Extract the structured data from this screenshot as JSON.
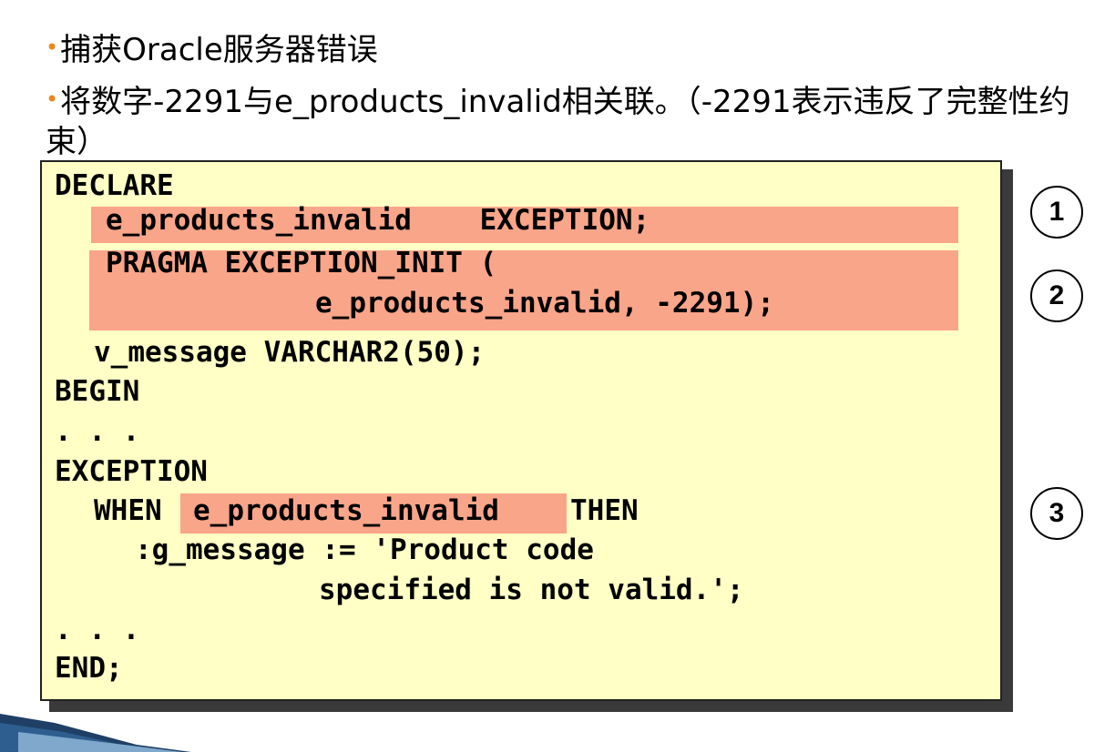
{
  "bullets": [
    {
      "text": "捕获Oracle服务器错误"
    },
    {
      "text": "将数字-2291与e_products_invalid相关联。（-2291表示违反了完整性约束）"
    }
  ],
  "code_lines": [
    "DECLARE",
    "e_products_invalid    EXCEPTION;",
    "PRAGMA EXCEPTION_INIT (",
    "e_products_invalid, -2291);",
    "v_message VARCHAR2(50);",
    "BEGIN",
    ". . .",
    "EXCEPTION",
    "WHEN",
    "e_products_invalid",
    "THEN",
    ":g_message := 'Product code",
    "specified is not valid.';",
    ". . .",
    "END;"
  ],
  "callouts": [
    "1",
    "2",
    "3"
  ],
  "colors": {
    "bullet": "#e8891d",
    "code_background": "#ffffc6",
    "highlight": "#f9a58a"
  }
}
